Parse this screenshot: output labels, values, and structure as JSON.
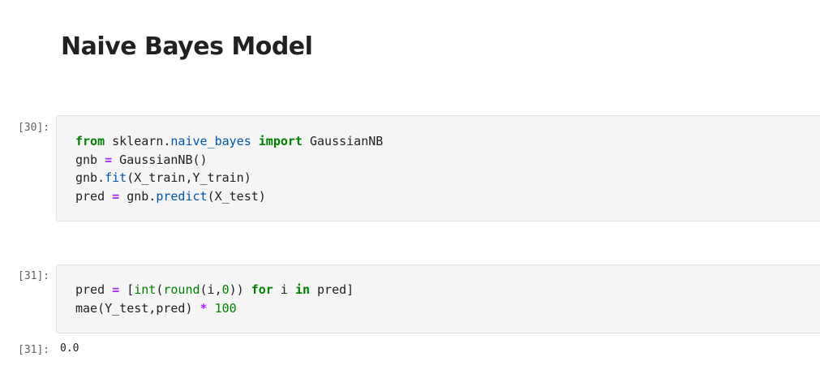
{
  "heading": "Naive Bayes Model",
  "cells": [
    {
      "prompt": "[30]:",
      "lines": [
        [
          {
            "t": "from",
            "c": "kw"
          },
          {
            "t": " sklearn.",
            "c": ""
          },
          {
            "t": "naive_bayes",
            "c": "nm"
          },
          {
            "t": " ",
            "c": ""
          },
          {
            "t": "import",
            "c": "kw"
          },
          {
            "t": " GaussianNB",
            "c": ""
          }
        ],
        [
          {
            "t": "gnb ",
            "c": ""
          },
          {
            "t": "=",
            "c": "op"
          },
          {
            "t": " GaussianNB()",
            "c": ""
          }
        ],
        [
          {
            "t": "gnb.",
            "c": ""
          },
          {
            "t": "fit",
            "c": "nm"
          },
          {
            "t": "(X_train,Y_train)",
            "c": ""
          }
        ],
        [
          {
            "t": "pred ",
            "c": ""
          },
          {
            "t": "=",
            "c": "op"
          },
          {
            "t": " gnb.",
            "c": ""
          },
          {
            "t": "predict",
            "c": "nm"
          },
          {
            "t": "(X_test)",
            "c": ""
          }
        ]
      ]
    },
    {
      "prompt": "[31]:",
      "lines": [
        [
          {
            "t": "pred ",
            "c": ""
          },
          {
            "t": "=",
            "c": "op"
          },
          {
            "t": " [",
            "c": ""
          },
          {
            "t": "int",
            "c": "bi"
          },
          {
            "t": "(",
            "c": ""
          },
          {
            "t": "round",
            "c": "bi"
          },
          {
            "t": "(i,",
            "c": ""
          },
          {
            "t": "0",
            "c": "num"
          },
          {
            "t": ")) ",
            "c": ""
          },
          {
            "t": "for",
            "c": "kw"
          },
          {
            "t": " i ",
            "c": ""
          },
          {
            "t": "in",
            "c": "kw"
          },
          {
            "t": " pred]",
            "c": ""
          }
        ],
        [
          {
            "t": "mae(Y_test,pred) ",
            "c": ""
          },
          {
            "t": "*",
            "c": "op"
          },
          {
            "t": " ",
            "c": ""
          },
          {
            "t": "100",
            "c": "num"
          }
        ]
      ],
      "output_prompt": "[31]:",
      "output": "0.0"
    }
  ]
}
